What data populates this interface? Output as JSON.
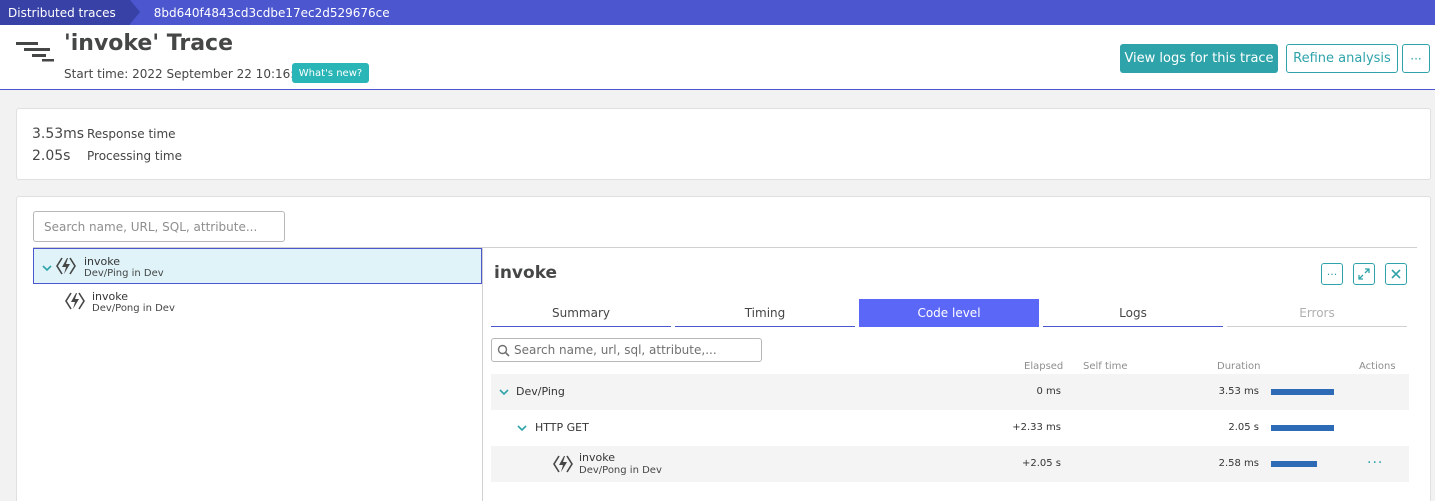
{
  "breadcrumb": {
    "root": "Distributed traces",
    "current": "8bd640f4843cd3cdbe17ec2d529676ce"
  },
  "header": {
    "title": "'invoke' Trace",
    "start_time": "Start time: 2022 September 22 10:16:18",
    "whats_new": "What's new?",
    "view_logs": "View logs for this trace",
    "refine": "Refine analysis",
    "more": "···"
  },
  "metrics": [
    {
      "value": "3.53ms",
      "label": "Response time"
    },
    {
      "value": "2.05s",
      "label": "Processing time"
    }
  ],
  "search": {
    "placeholder": "Search name, URL, SQL, attribute..."
  },
  "tree": [
    {
      "name": "invoke",
      "sub": "Dev/Ping in Dev",
      "selected": true
    },
    {
      "name": "invoke",
      "sub": "Dev/Pong in Dev",
      "selected": false
    }
  ],
  "detail": {
    "title": "invoke",
    "more": "···",
    "expand": "⤢",
    "close": "✕",
    "tabs": [
      "Summary",
      "Timing",
      "Code level",
      "Logs",
      "Errors"
    ],
    "active_tab": "Code level",
    "search_placeholder": "Search name, url, sql, attribute,...",
    "columns": {
      "elapsed": "Elapsed",
      "self_time": "Self time",
      "duration": "Duration",
      "actions": "Actions"
    },
    "rows": [
      {
        "name": "Dev/Ping",
        "elapsed": "0 ms",
        "duration": "3.53 ms",
        "bar_fraction": 1.0
      },
      {
        "name": "HTTP GET",
        "elapsed": "+2.33 ms",
        "duration": "2.05 s",
        "bar_fraction": 1.0
      },
      {
        "name": "invoke",
        "sub": "Dev/Pong in Dev",
        "elapsed": "+2.05 s",
        "duration": "2.58 ms",
        "bar_fraction": 0.73,
        "actions": "···"
      }
    ]
  },
  "colors": {
    "brand": "#4b56cf",
    "accent": "#2ea3aa",
    "active_tab": "#5b67f6",
    "bar": "#2e6bb6"
  }
}
